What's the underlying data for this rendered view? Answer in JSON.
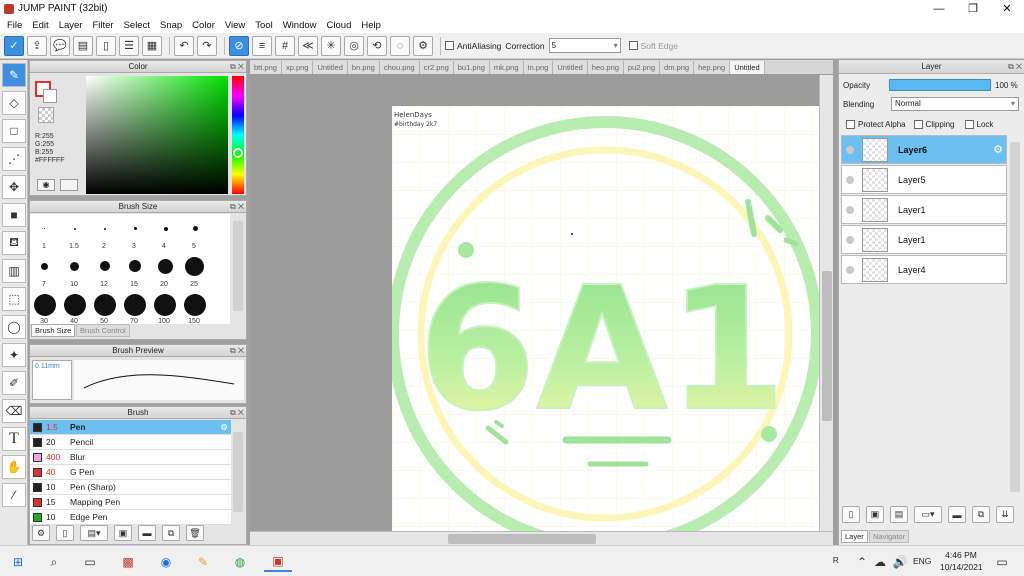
{
  "window": {
    "title": "JUMP PAINT (32bit)",
    "min": "—",
    "max": "❐",
    "close": "✕"
  },
  "menu": [
    "File",
    "Edit",
    "Layer",
    "Filter",
    "Select",
    "Snap",
    "Color",
    "View",
    "Tool",
    "Window",
    "Cloud",
    "Help"
  ],
  "toolbar": {
    "antialias_label": "AntiAliasing",
    "correction_label": "Correction",
    "correction_value": "5",
    "softedge_label": "Soft Edge"
  },
  "color_panel": {
    "title": "Color",
    "r": "R:255",
    "g": "G:255",
    "b": "B:255",
    "hex": "#FFFFFF"
  },
  "brush_size_panel": {
    "title": "Brush Size",
    "sizes": [
      "1",
      "1.5",
      "2",
      "3",
      "4",
      "5",
      "7",
      "10",
      "12",
      "15",
      "20",
      "25",
      "30",
      "40",
      "50",
      "70",
      "100",
      "150"
    ],
    "tab_active": "Brush Size",
    "tab_inactive": "Brush Control"
  },
  "brush_preview_panel": {
    "title": "Brush Preview",
    "size": "0.11mm"
  },
  "brush_panel": {
    "title": "Brush",
    "items": [
      {
        "size": "1.5",
        "name": "Pen",
        "color": "#222222"
      },
      {
        "size": "20",
        "name": "Pencil",
        "color": "#222222"
      },
      {
        "size": "400",
        "name": "Blur",
        "color": "#f4a0e8"
      },
      {
        "size": "40",
        "name": "G Pen",
        "color": "#e03030"
      },
      {
        "size": "10",
        "name": "Pen (Sharp)",
        "color": "#222222"
      },
      {
        "size": "15",
        "name": "Mapping Pen",
        "color": "#e03030"
      },
      {
        "size": "10",
        "name": "Edge Pen",
        "color": "#22aa22"
      }
    ]
  },
  "tabs": [
    "btt.png",
    "xp.png",
    "Untitled",
    "bn.png",
    "chou.png",
    "cr2.png",
    "bu1.png",
    "mk.png",
    "tn.png",
    "Untitled",
    "heo.png",
    "pu2.png",
    "dm.png",
    "hep.png",
    "Untitled"
  ],
  "canvas": {
    "artwork_text": "6A1",
    "signature_line1": "HelenDays",
    "signature_line2": "#birthday 2k7"
  },
  "layer_panel": {
    "title": "Layer",
    "opacity_label": "Opacity",
    "opacity_value": "100 %",
    "blending_label": "Blending",
    "blending_value": "Normal",
    "protect_alpha": "Protect Alpha",
    "clipping": "Clipping",
    "lock": "Lock",
    "layers": [
      "Layer6",
      "Layer5",
      "Layer1",
      "Layer1",
      "Layer4"
    ],
    "bottom_tab_active": "Layer",
    "bottom_tab_inactive": "Navigator"
  },
  "taskbar": {
    "time": "4:46 PM",
    "date": "10/14/2021",
    "lang": "ENG"
  },
  "colors": {
    "accent": "#3d8fe0",
    "selected_layer": "#6cbff0",
    "art_green": "#8fe08f",
    "art_yellow": "#fdf6a8"
  }
}
